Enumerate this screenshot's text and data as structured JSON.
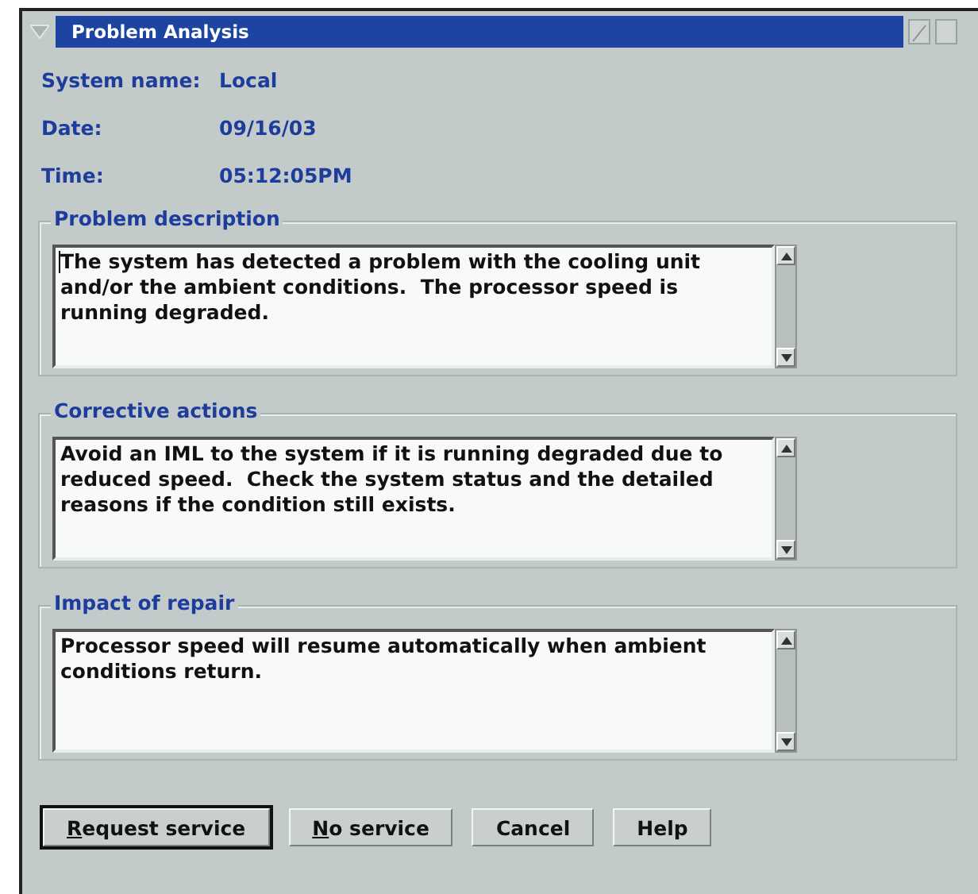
{
  "window": {
    "title": "Problem Analysis"
  },
  "fields": [
    {
      "label": "System name:",
      "value": "Local"
    },
    {
      "label": "Date:",
      "value": "09/16/03"
    },
    {
      "label": "Time:",
      "value": "05:12:05PM"
    }
  ],
  "groups": [
    {
      "title": "Problem description",
      "text": "The system has detected a problem with the cooling unit and/or the ambient conditions.  The processor speed is running degraded.",
      "focused": true
    },
    {
      "title": "Corrective actions",
      "text": "Avoid an IML to the system if it is running degraded due to reduced speed.  Check the system status and the detailed reasons if the condition still exists.",
      "focused": false
    },
    {
      "title": "Impact of repair",
      "text": "Processor speed will resume automatically when ambient conditions return.",
      "focused": false
    }
  ],
  "buttons": [
    {
      "label": "Request service",
      "default": true,
      "mnemonic": true
    },
    {
      "label": "No service",
      "default": false,
      "mnemonic": true
    },
    {
      "label": "Cancel",
      "default": false,
      "mnemonic": false
    },
    {
      "label": "Help",
      "default": false,
      "mnemonic": false
    }
  ]
}
